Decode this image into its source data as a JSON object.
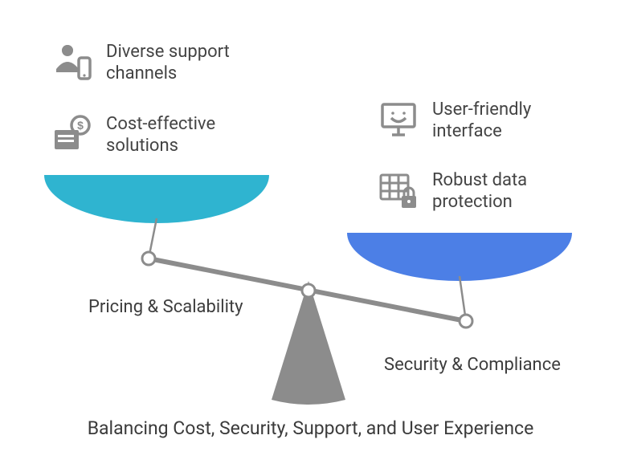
{
  "left": {
    "items": [
      {
        "text": "Diverse support channels",
        "icon": "person-phone-icon"
      },
      {
        "text": "Cost-effective solutions",
        "icon": "wallet-dollar-icon"
      }
    ],
    "label": "Pricing & Scalability",
    "pan_color": "#2FB4D0"
  },
  "right": {
    "items": [
      {
        "text": "User-friendly interface",
        "icon": "monitor-smile-icon"
      },
      {
        "text": "Robust data protection",
        "icon": "data-lock-icon"
      }
    ],
    "label": "Security & Compliance",
    "pan_color": "#4C7FE6"
  },
  "caption": "Balancing Cost, Security, Support, and User Experience",
  "colors": {
    "icon": "#8C8C8C",
    "mech": "#8C8C8C",
    "text": "#3d3d3d"
  }
}
